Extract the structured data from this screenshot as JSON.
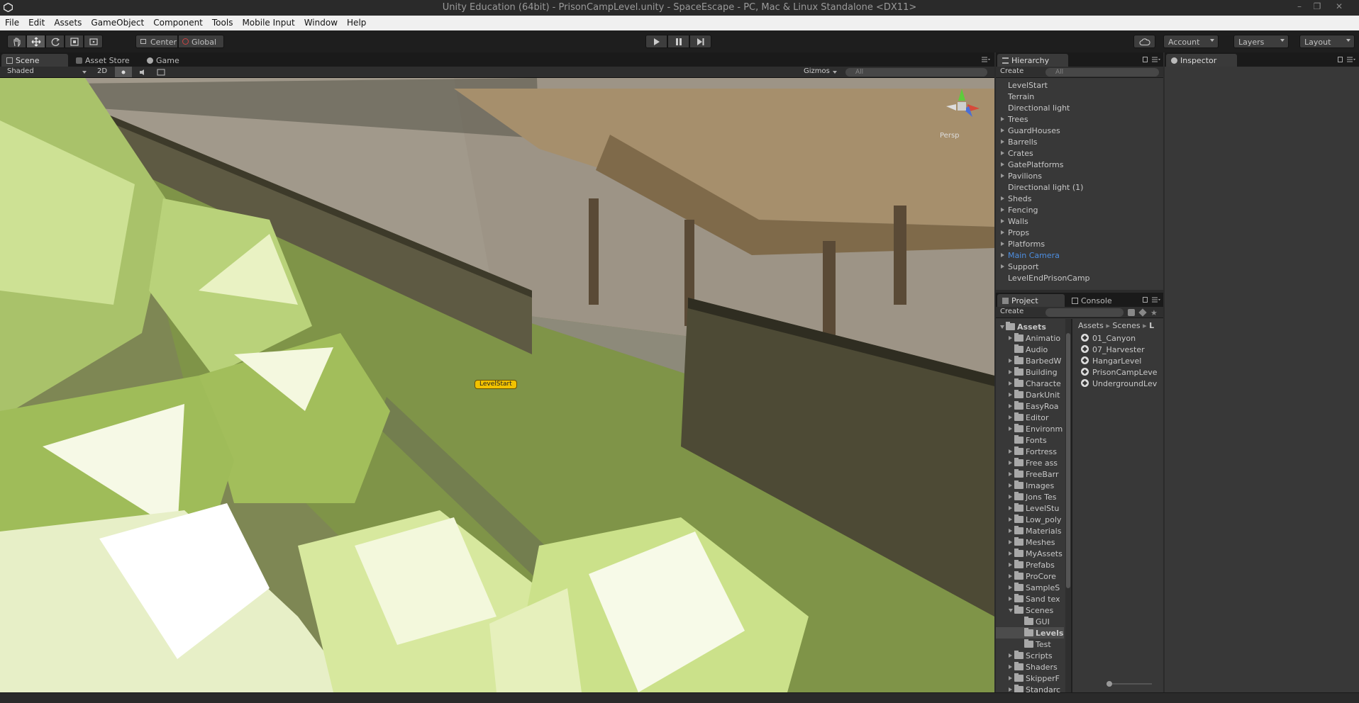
{
  "window": {
    "title": "Unity Education (64bit) - PrisonCampLevel.unity - SpaceEscape - PC, Mac & Linux Standalone <DX11>"
  },
  "menu": [
    "File",
    "Edit",
    "Assets",
    "GameObject",
    "Component",
    "Tools",
    "Mobile Input",
    "Window",
    "Help"
  ],
  "toolbar": {
    "pivot_label": "Center",
    "space_label": "Global",
    "account_label": "Account",
    "layers_label": "Layers",
    "layout_label": "Layout"
  },
  "scene_tabs": [
    "Scene",
    "Asset Store",
    "Game"
  ],
  "scene_toolbar": {
    "shading": "Shaded",
    "mode_2d": "2D",
    "gizmos": "Gizmos",
    "search_placeholder": "All"
  },
  "scene_view": {
    "persp_label": "Persp",
    "level_start_tag": "LevelStart"
  },
  "hierarchy": {
    "tab": "Hierarchy",
    "create": "Create",
    "search_placeholder": "All",
    "items": [
      {
        "label": "LevelStart",
        "expandable": false
      },
      {
        "label": "Terrain",
        "expandable": false
      },
      {
        "label": "Directional light",
        "expandable": false
      },
      {
        "label": "Trees",
        "expandable": true
      },
      {
        "label": "GuardHouses",
        "expandable": true
      },
      {
        "label": "Barrells",
        "expandable": true
      },
      {
        "label": "Crates",
        "expandable": true
      },
      {
        "label": "GatePlatforms",
        "expandable": true
      },
      {
        "label": "Pavilions",
        "expandable": true
      },
      {
        "label": "Directional light (1)",
        "expandable": false
      },
      {
        "label": "Sheds",
        "expandable": true
      },
      {
        "label": "Fencing",
        "expandable": true
      },
      {
        "label": "Walls",
        "expandable": true
      },
      {
        "label": "Props",
        "expandable": true
      },
      {
        "label": "Platforms",
        "expandable": true
      },
      {
        "label": "Main Camera",
        "expandable": true
      },
      {
        "label": "Support",
        "expandable": true
      },
      {
        "label": "LevelEndPrisonCamp",
        "expandable": false
      }
    ]
  },
  "project": {
    "tabs": [
      "Project",
      "Console"
    ],
    "create": "Create",
    "breadcrumb": [
      "Assets",
      "Scenes",
      "L"
    ],
    "tree_root": "Assets",
    "folders": [
      "Animatio",
      "Audio",
      "BarbedW",
      "Building",
      "Characte",
      "DarkUnit",
      "EasyRoa",
      "Editor",
      "Environm",
      "Fonts",
      "Fortress",
      "Free ass",
      "FreeBarr",
      "Images",
      "Jons Tes",
      "LevelStu",
      "Low_poly",
      "Materials",
      "Meshes",
      "MyAssets",
      "Prefabs",
      "ProCore",
      "SampleS",
      "Sand tex",
      "Scenes",
      "GUI",
      "Levels",
      "Test",
      "Scripts",
      "Shaders",
      "SkipperF",
      "Standarc"
    ],
    "scenes": [
      "01_Canyon",
      "07_Harvester",
      "HangarLevel",
      "PrisonCampLeve",
      "UndergroundLev"
    ]
  },
  "inspector": {
    "tab": "Inspector"
  },
  "colors": {
    "selected_text": "#4d8ee0",
    "panel_bg": "#383838",
    "level_tag": "#f2c200"
  }
}
